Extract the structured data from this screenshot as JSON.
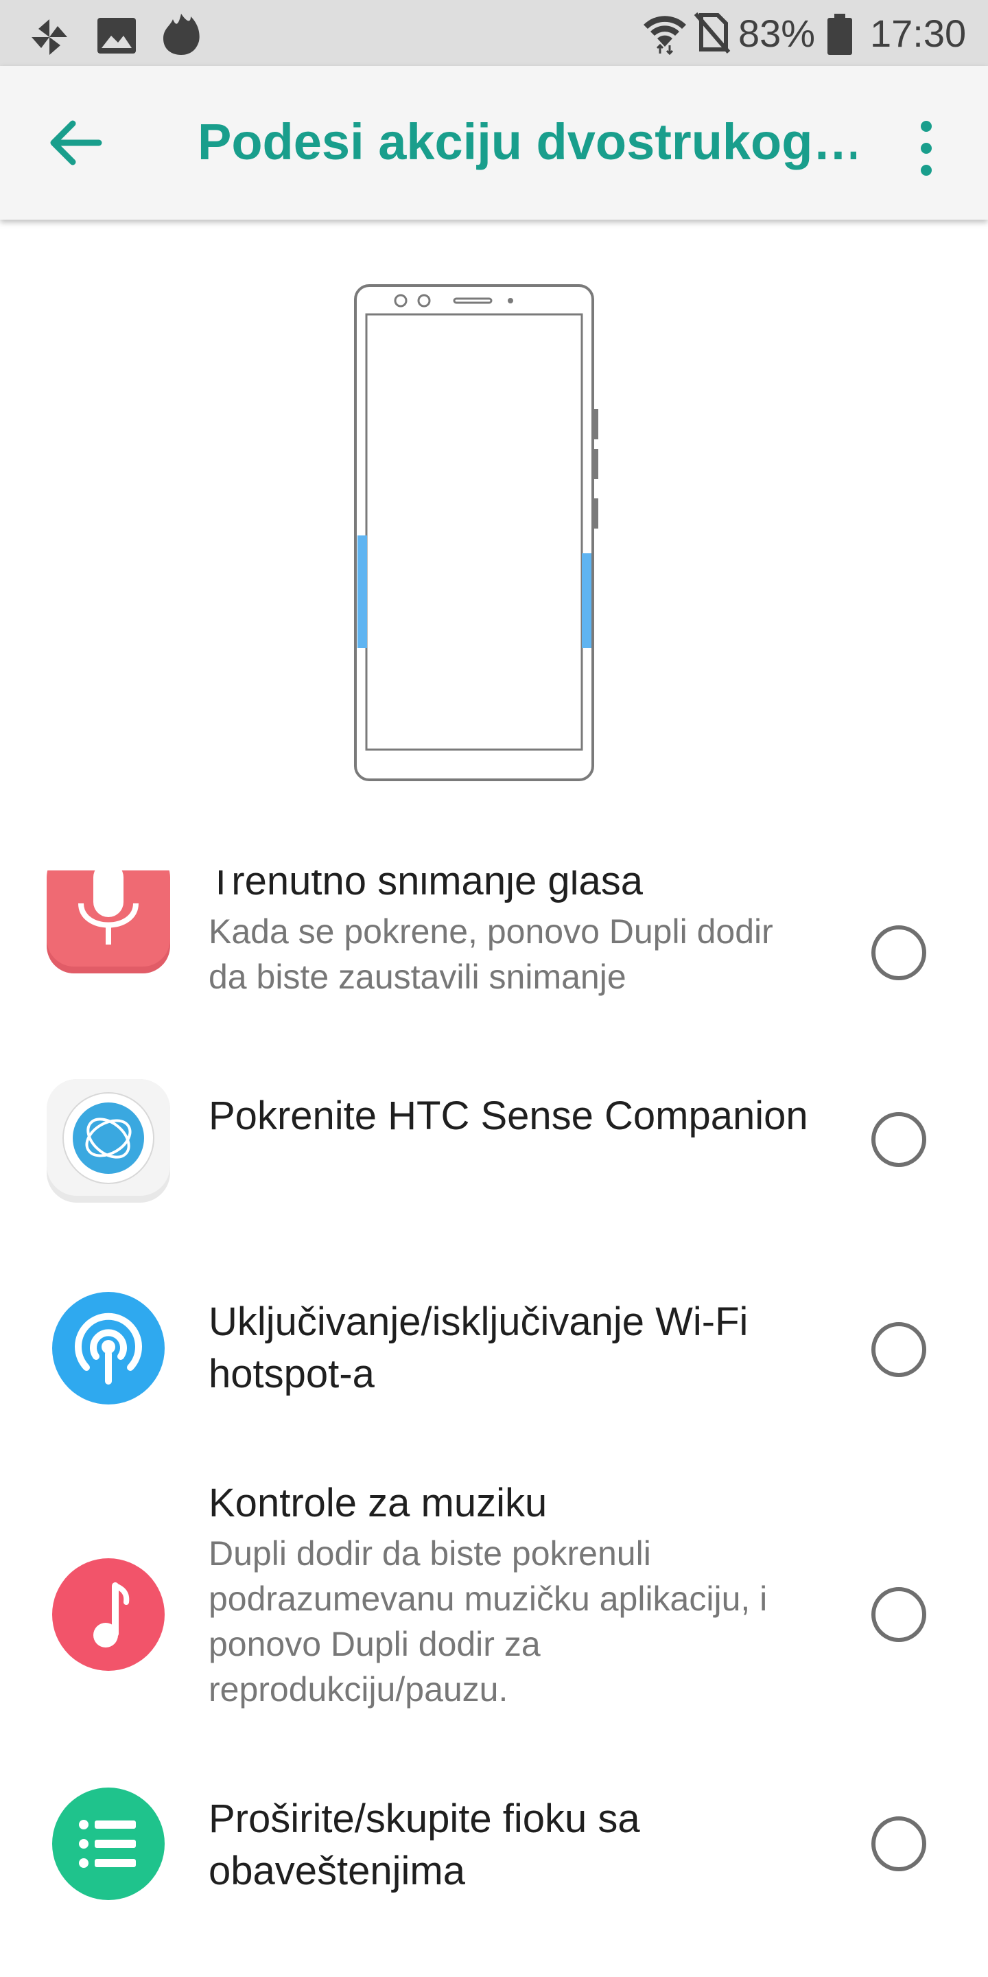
{
  "status_bar": {
    "battery": "83%",
    "time": "17:30",
    "icons": [
      "pinwheel-icon",
      "image-icon",
      "flame-icon",
      "wifi-icon",
      "no-sim-icon",
      "battery-icon"
    ]
  },
  "app_bar": {
    "title": "Podesi akciju dvostrukog…",
    "icons": [
      "back-arrow-icon",
      "more-vert-icon"
    ]
  },
  "illustration": {
    "name": "phone-squeeze-illustration"
  },
  "options": [
    {
      "title": "Trenutno snimanje glasa",
      "summary": "Kada se pokrene, ponovo Dupli dodir da biste zaustavili snimanje",
      "icon": "microphone-icon",
      "selected": false
    },
    {
      "title": "Pokrenite HTC Sense Companion",
      "summary": "",
      "icon": "sense-companion-icon",
      "selected": false
    },
    {
      "title": "Uključivanje/isključivanje Wi-Fi hotspot-a",
      "summary": "",
      "icon": "hotspot-icon",
      "selected": false
    },
    {
      "title": "Kontrole za muziku",
      "summary": "Dupli dodir da biste pokrenuli podrazumevanu muzičku aplikaciju, i ponovo Dupli dodir za reprodukciju/pauzu.",
      "icon": "music-note-icon",
      "selected": false
    },
    {
      "title": "Proširite/skupite fioku sa obaveštenjima",
      "summary": "",
      "icon": "notification-list-icon",
      "selected": false
    }
  ],
  "colors": {
    "accent": "#199e8c",
    "mic": "#ef6a73",
    "hotspot": "#2fa9ef",
    "music": "#f2546a",
    "notification": "#1fc38c",
    "squeeze_zone": "#5fb4f1"
  }
}
